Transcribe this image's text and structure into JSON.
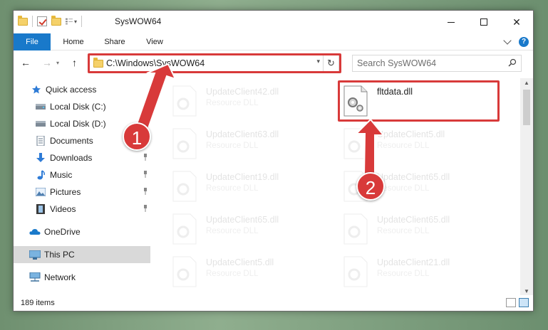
{
  "titlebar": {
    "title": "SysWOW64"
  },
  "ribbon": {
    "tabs": [
      {
        "label": "File"
      },
      {
        "label": "Home"
      },
      {
        "label": "Share"
      },
      {
        "label": "View"
      }
    ]
  },
  "address": {
    "path": "C:\\Windows\\SysWOW64"
  },
  "search": {
    "placeholder": "Search SysWOW64"
  },
  "sidebar": {
    "items": [
      {
        "label": "Quick access",
        "icon": "star-icon"
      },
      {
        "label": "Local Disk (C:)",
        "icon": "drive-icon",
        "pinned": true
      },
      {
        "label": "Local Disk (D:)",
        "icon": "drive-icon"
      },
      {
        "label": "Documents",
        "icon": "documents-icon"
      },
      {
        "label": "Downloads",
        "icon": "download-icon",
        "pinned": true
      },
      {
        "label": "Music",
        "icon": "music-icon",
        "pinned": true
      },
      {
        "label": "Pictures",
        "icon": "pictures-icon",
        "pinned": true
      },
      {
        "label": "Videos",
        "icon": "videos-icon",
        "pinned": true
      },
      {
        "label": "OneDrive",
        "icon": "cloud-icon"
      },
      {
        "label": "This PC",
        "icon": "computer-icon",
        "selected": true
      },
      {
        "label": "Network",
        "icon": "network-icon"
      }
    ]
  },
  "files": [
    {
      "name": "UpdateClient42.dll",
      "type": "Resource DLL"
    },
    {
      "name": "fltdata.dll",
      "type": ""
    },
    {
      "name": "UpdateClient63.dll",
      "type": "Resource DLL"
    },
    {
      "name": "UpdateClient5.dll",
      "type": "Resource DLL"
    },
    {
      "name": "UpdateClient19.dll",
      "type": "Resource DLL"
    },
    {
      "name": "UpdateClient65.dll",
      "type": "Resource DLL"
    },
    {
      "name": "UpdateClient65.dll",
      "type": "Resource DLL"
    },
    {
      "name": "UpdateClient65.dll",
      "type": "Resource DLL"
    },
    {
      "name": "UpdateClient5.dll",
      "type": "Resource DLL"
    },
    {
      "name": "UpdateClient21.dll",
      "type": "Resource DLL"
    }
  ],
  "status": {
    "count": "189 items"
  },
  "annotations": {
    "badge1": "1",
    "badge2": "2"
  },
  "colors": {
    "accent": "#1979ca",
    "highlight": "#d83a3a",
    "selected": "#d9d9d9"
  }
}
